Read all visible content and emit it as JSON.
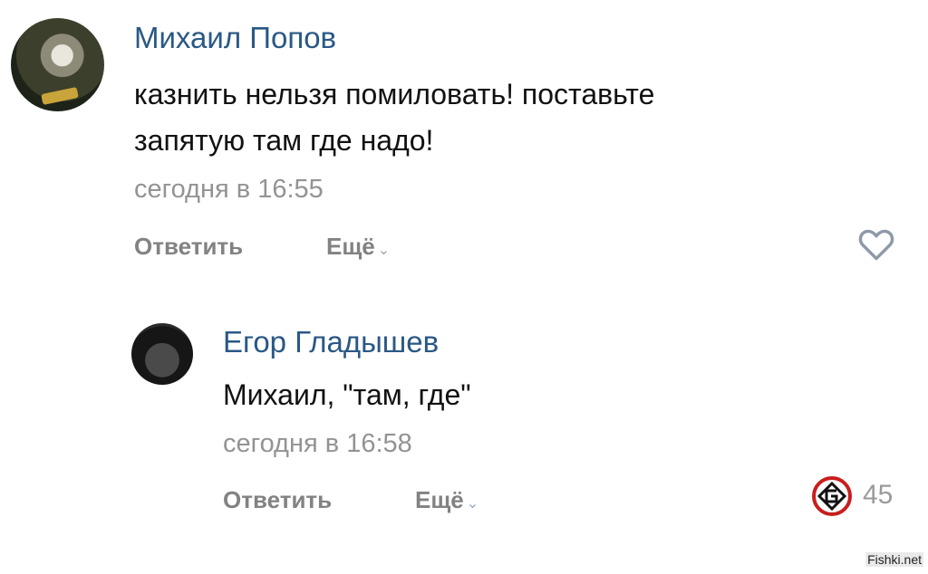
{
  "comments": [
    {
      "author": "Михаил Попов",
      "text_line1": "казнить нельзя помиловать! поставьте",
      "text_line2": "запятую там где надо!",
      "time": "сегодня в 16:55",
      "reply_label": "Ответить",
      "more_label": "Ещё",
      "like_icon": "heart-outline-icon"
    },
    {
      "author": "Егор Гладышев",
      "text": "Михаил, \"там, где\"",
      "time": "сегодня в 16:58",
      "reply_label": "Ответить",
      "more_label": "Ещё",
      "like_count": "45",
      "like_icon": "reaction-badge-icon"
    }
  ],
  "watermark": "Fishki.net"
}
